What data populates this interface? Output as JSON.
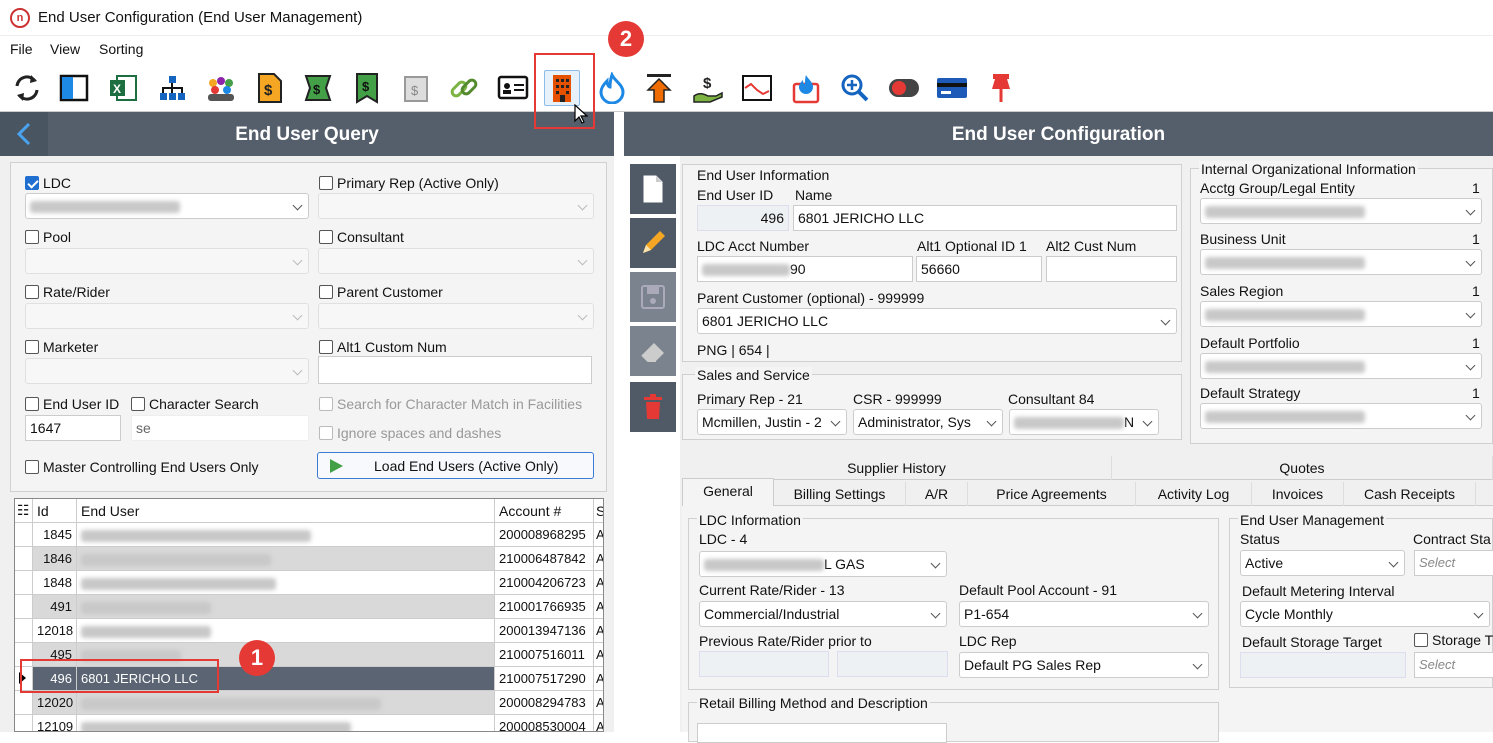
{
  "window": {
    "title": "End User Configuration (End User Management)"
  },
  "menu": {
    "file": "File",
    "view": "View",
    "sorting": "Sorting"
  },
  "toolbar": {
    "icons": [
      "refresh-icon",
      "panel-icon",
      "excel-icon",
      "hierarchy-icon",
      "users-icon",
      "dollar-doc-icon",
      "money-icon",
      "dollar-bookmark-icon",
      "calendar-dollar-icon",
      "link-icon",
      "id-card-icon",
      "building-icon",
      "flame-icon",
      "upload-arrow-icon",
      "hand-dollar-icon",
      "chart-icon",
      "gas-flame-icon",
      "zoom-icon",
      "toggle-icon",
      "card-icon",
      "pin-icon"
    ]
  },
  "left": {
    "title": "End User Query",
    "ldc_label": "LDC",
    "primary_rep_label": "Primary Rep (Active Only)",
    "pool_label": "Pool",
    "consultant_label": "Consultant",
    "rate_rider_label": "Rate/Rider",
    "parent_customer_label": "Parent Customer",
    "marketer_label": "Marketer",
    "alt1_label": "Alt1 Custom Num",
    "end_user_id_label": "End User ID",
    "character_search_label": "Character Search",
    "search_char_label": "Search for Character Match in Facilities",
    "ignore_spaces_label": "Ignore spaces and dashes",
    "end_user_id_value": "1647",
    "character_search_value": "se",
    "master_controlling_label": "Master Controlling End Users Only",
    "load_button": "Load End Users (Active Only)",
    "grid": {
      "headers": {
        "id": "Id",
        "end_user": "End User",
        "account": "Account #",
        "s": "S"
      },
      "rows": [
        {
          "id": "1845",
          "name": "",
          "account": "200008968295",
          "s": "A"
        },
        {
          "id": "1846",
          "name": "",
          "account": "210006487842",
          "s": "A"
        },
        {
          "id": "1848",
          "name": "",
          "account": "210004206723",
          "s": "A"
        },
        {
          "id": "491",
          "name": "",
          "account": "210001766935",
          "s": "A"
        },
        {
          "id": "12018",
          "name": "",
          "account": "200013947136",
          "s": "A"
        },
        {
          "id": "495",
          "name": "",
          "account": "210007516011",
          "s": "A"
        },
        {
          "id": "496",
          "name": "6801 JERICHO LLC",
          "account": "210007517290",
          "s": "A"
        },
        {
          "id": "12020",
          "name": "",
          "account": "200008294783",
          "s": "A"
        },
        {
          "id": "12109",
          "name": "",
          "account": "200008530004",
          "s": "A"
        }
      ]
    }
  },
  "right": {
    "title": "End User Configuration",
    "end_user_info": {
      "title": "End User Information",
      "id_label": "End User ID",
      "name_label": "Name",
      "id_value": "496",
      "name_value": "6801 JERICHO LLC",
      "ldc_acct_label": "LDC Acct Number",
      "ldc_acct_value": "90",
      "alt1_label": "Alt1 Optional ID 1",
      "alt1_value": "56660",
      "alt2_label": "Alt2  Cust Num",
      "parent_label": "Parent Customer (optional) - 999999",
      "parent_value": "6801 JERICHO LLC",
      "png_text": "PNG  |  654  |"
    },
    "sales": {
      "title": "Sales and Service",
      "primary_rep_label": "Primary Rep - 21",
      "primary_rep_value": "Mcmillen, Justin - 2",
      "csr_label": "CSR - 999999",
      "csr_value": "Administrator, Sys",
      "consultant_label": "Consultant  84",
      "consultant_value": "N"
    },
    "internal": {
      "title": "Internal Organizational Information",
      "acctg_label": "Acctg Group/Legal Entity",
      "business_unit_label": "Business Unit",
      "sales_region_label": "Sales Region",
      "default_portfolio_label": "Default Portfolio",
      "default_strategy_label": "Default Strategy",
      "count": "1"
    },
    "tabs_top": {
      "supplier_history": "Supplier History",
      "quotes": "Quotes"
    },
    "tabs": [
      "General",
      "Billing Settings",
      "A/R",
      "Price Agreements",
      "Activity Log",
      "Invoices",
      "Cash Receipts"
    ],
    "ldc_info": {
      "title": "LDC Information",
      "ldc_label": "LDC - 4",
      "ldc_value": "L GAS",
      "current_rate_label": "Current Rate/Rider - 13",
      "current_rate_value": "Commercial/Industrial",
      "default_pool_label": "Default Pool Account - 91",
      "default_pool_value": "P1-654",
      "prev_rate_label": "Previous Rate/Rider prior to",
      "ldc_rep_label": "LDC Rep",
      "ldc_rep_value": "Default PG Sales Rep"
    },
    "eum": {
      "title": "End User Management",
      "status_label": "Status",
      "status_value": "Active",
      "contract_label": "Contract Sta",
      "select_placeholder": "Select",
      "metering_label": "Default Metering Interval",
      "metering_value": "Cycle Monthly",
      "storage_target_label": "Default Storage Target",
      "storage_label": "Storage T"
    },
    "retail_billing_title": "Retail Billing Method and Description"
  },
  "markers": {
    "one": "1",
    "two": "2"
  }
}
